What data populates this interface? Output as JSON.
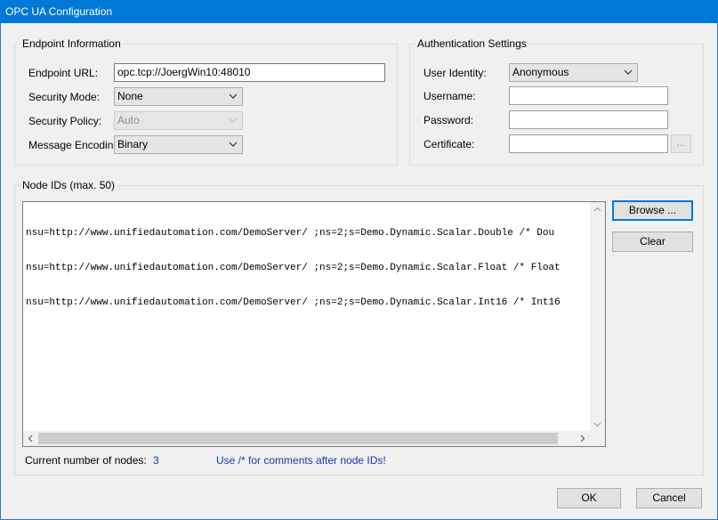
{
  "window": {
    "title": "OPC UA Configuration"
  },
  "endpoint": {
    "group_title": "Endpoint Information",
    "url_label": "Endpoint URL:",
    "url_value": "opc.tcp://JoergWin10:48010",
    "security_mode_label": "Security Mode:",
    "security_mode_value": "None",
    "security_policy_label": "Security Policy:",
    "security_policy_value": "Auto",
    "encoding_label": "Message Encoding:",
    "encoding_value": "Binary"
  },
  "auth": {
    "group_title": "Authentication Settings",
    "identity_label": "User Identity:",
    "identity_value": "Anonymous",
    "username_label": "Username:",
    "username_value": "",
    "password_label": "Password:",
    "password_value": "",
    "certificate_label": "Certificate:",
    "certificate_value": "",
    "browse_cert_label": "..."
  },
  "nodes": {
    "group_title": "Node IDs (max. 50)",
    "lines": [
      "nsu=http://www.unifiedautomation.com/DemoServer/ ;ns=2;s=Demo.Dynamic.Scalar.Double /* Dou",
      "nsu=http://www.unifiedautomation.com/DemoServer/ ;ns=2;s=Demo.Dynamic.Scalar.Float /* Float",
      "nsu=http://www.unifiedautomation.com/DemoServer/ ;ns=2;s=Demo.Dynamic.Scalar.Int16 /* Int16"
    ],
    "browse_label": "Browse ...",
    "clear_label": "Clear",
    "count_label": "Current number of nodes:",
    "count_value": "3",
    "hint": "Use /* for comments after  node IDs!"
  },
  "footer": {
    "ok_label": "OK",
    "cancel_label": "Cancel"
  },
  "colors": {
    "titlebar": "#0078d7",
    "hint_text": "#1a3aa8"
  }
}
